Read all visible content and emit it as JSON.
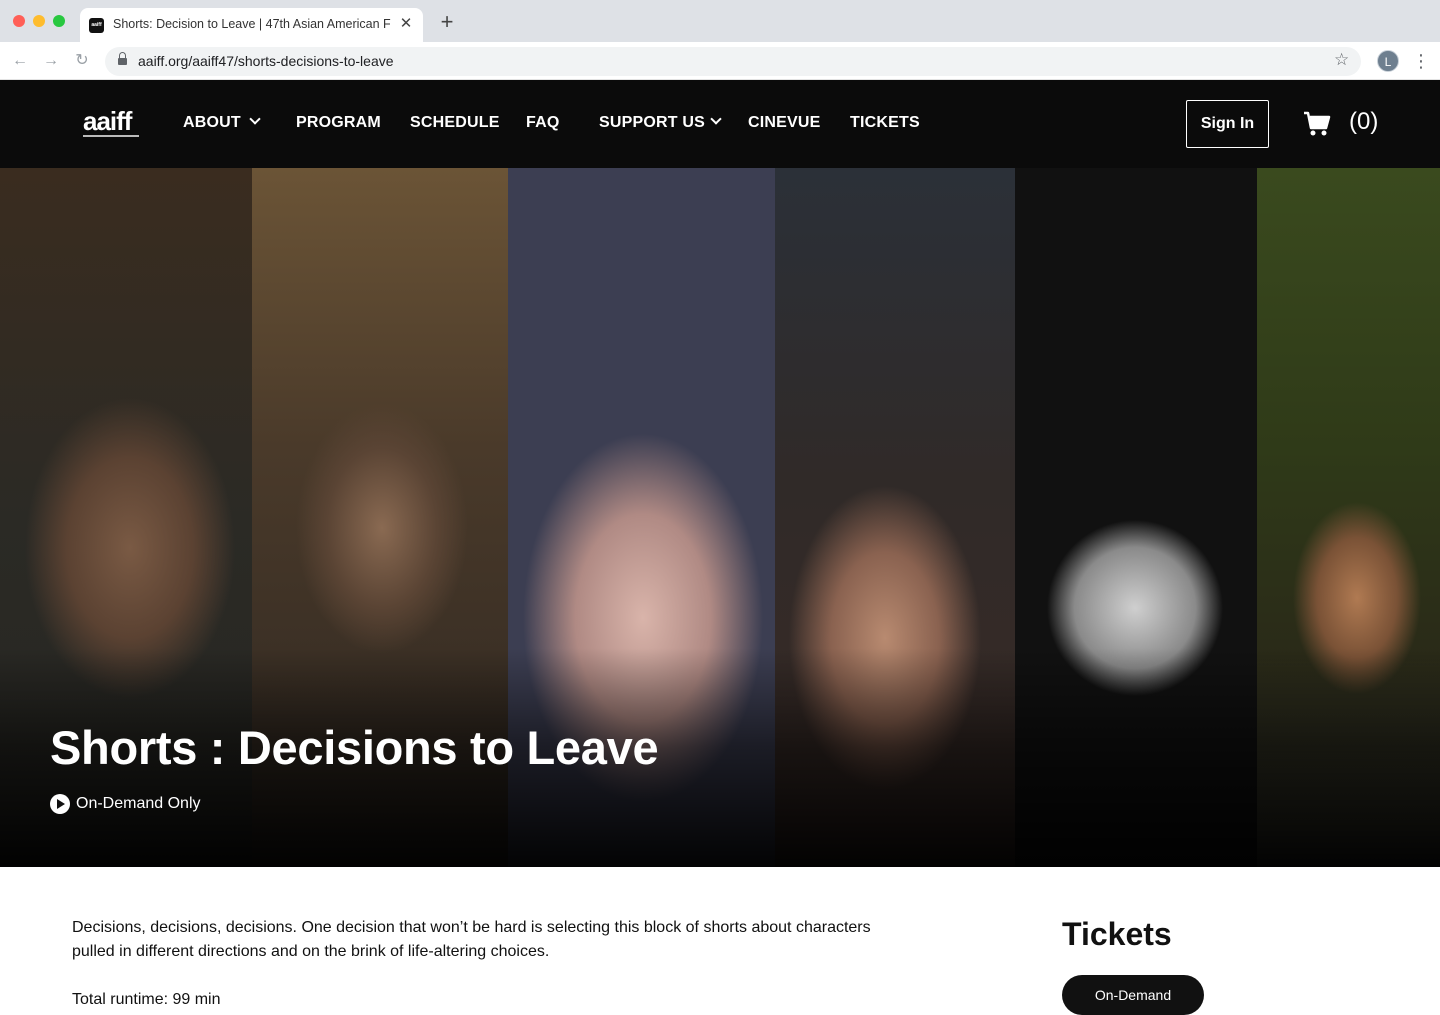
{
  "browser": {
    "tab_title": "Shorts: Decision to Leave | 47th Asian American F",
    "favicon_text": "aaiff",
    "url": "aaiff.org/aaiff47/shorts-decisions-to-leave",
    "profile_initial": "L"
  },
  "site": {
    "logo": "aaiff",
    "nav": [
      {
        "label": "ABOUT",
        "has_dropdown": true
      },
      {
        "label": "PROGRAM",
        "has_dropdown": false
      },
      {
        "label": "SCHEDULE",
        "has_dropdown": false
      },
      {
        "label": "FAQ",
        "has_dropdown": false
      },
      {
        "label": "SUPPORT US",
        "has_dropdown": true
      },
      {
        "label": "CINEVUE",
        "has_dropdown": false
      },
      {
        "label": "TICKETS",
        "has_dropdown": false
      }
    ],
    "sign_in": "Sign In",
    "cart_count": "(0)"
  },
  "hero": {
    "title": "Shorts : Decisions to Leave",
    "badge": "On-Demand Only"
  },
  "content": {
    "description": "Decisions, decisions, decisions. One decision that won’t be hard is selecting this block of shorts about characters pulled in different directions and on the brink of life-altering choices.",
    "runtime": "Total runtime: 99 min"
  },
  "tickets": {
    "heading": "Tickets",
    "button": "On-Demand"
  },
  "colors": {
    "header_bg": "#0b0b0b",
    "accent": "#111111"
  }
}
